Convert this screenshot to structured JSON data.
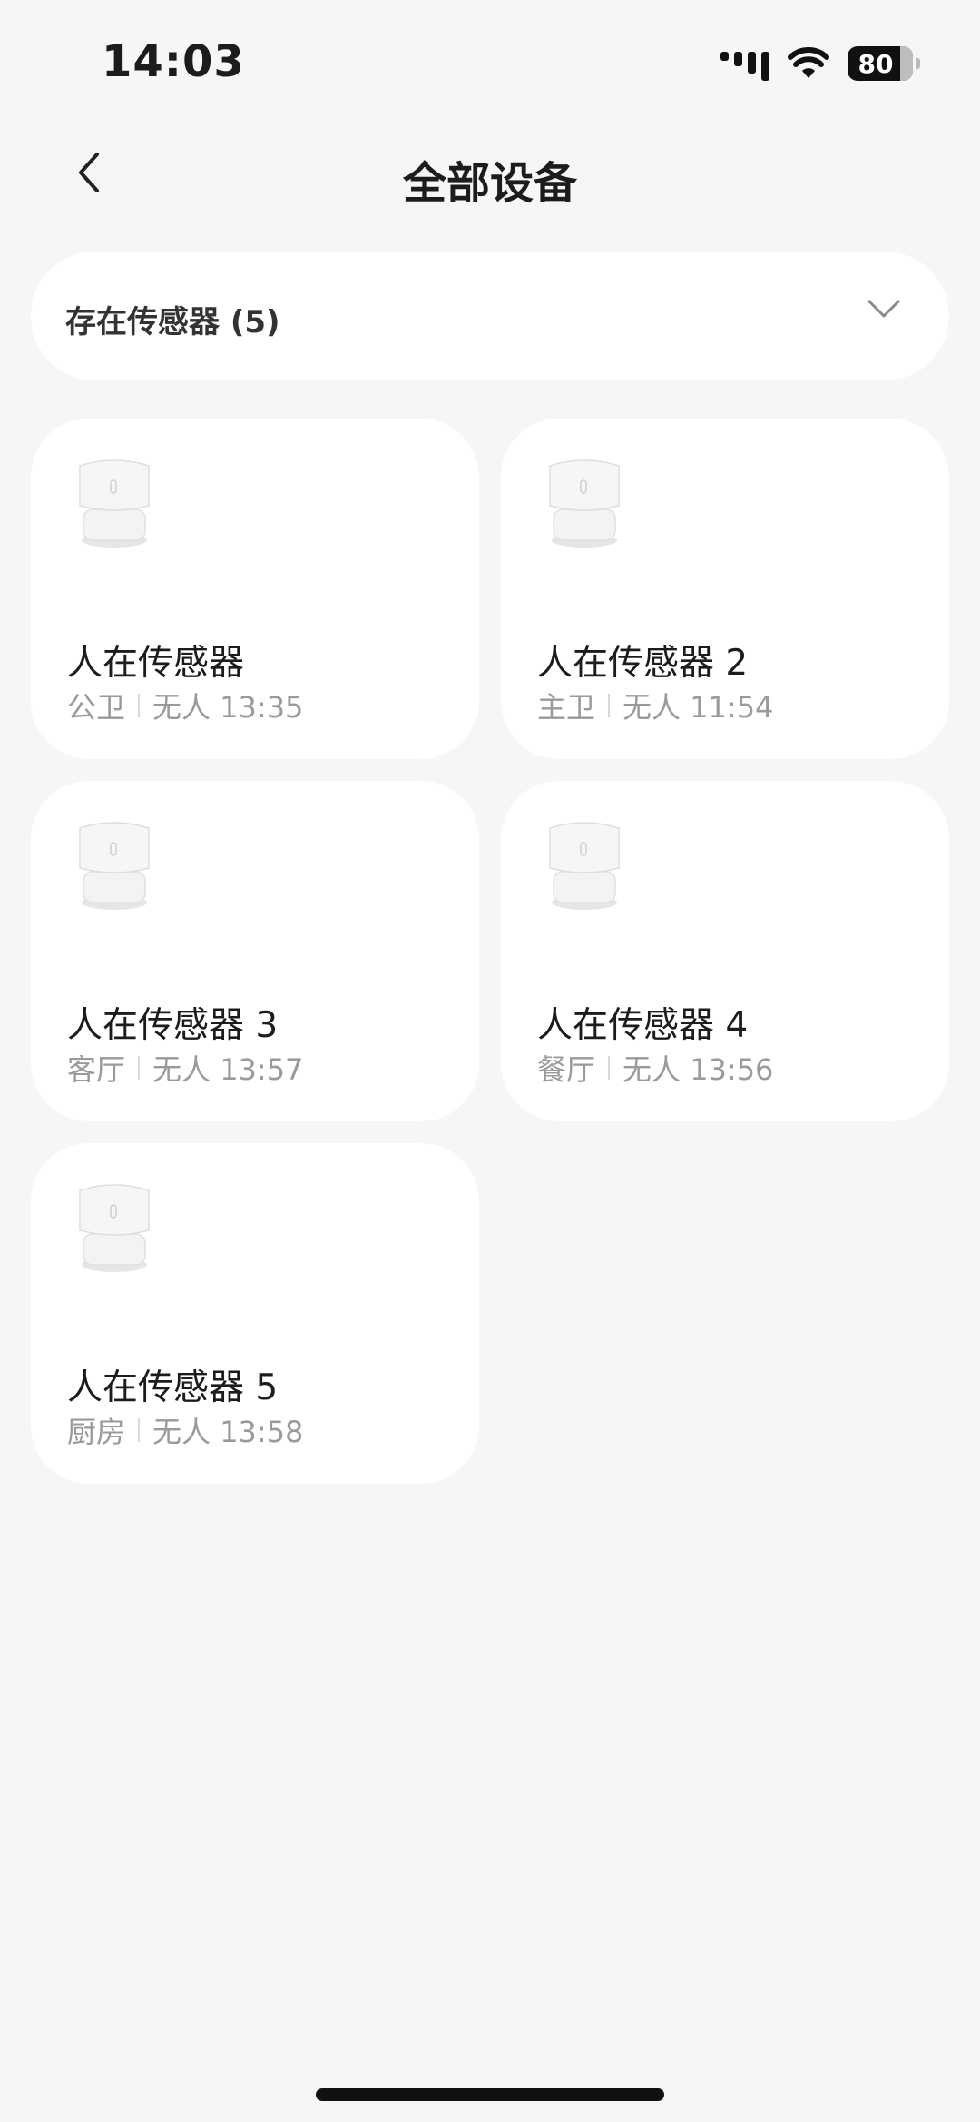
{
  "status_bar": {
    "time": "14:03",
    "battery": "80"
  },
  "header": {
    "title": "全部设备"
  },
  "filter": {
    "label": "存在传感器 (5)"
  },
  "devices": [
    {
      "name": "人在传感器",
      "room": "公卫",
      "status": "无人 13:35"
    },
    {
      "name": "人在传感器 2",
      "room": "主卫",
      "status": "无人 11:54"
    },
    {
      "name": "人在传感器 3",
      "room": "客厅",
      "status": "无人 13:57"
    },
    {
      "name": "人在传感器 4",
      "room": "餐厅",
      "status": "无人 13:56"
    },
    {
      "name": "人在传感器 5",
      "room": "厨房",
      "status": "无人 13:58"
    }
  ]
}
